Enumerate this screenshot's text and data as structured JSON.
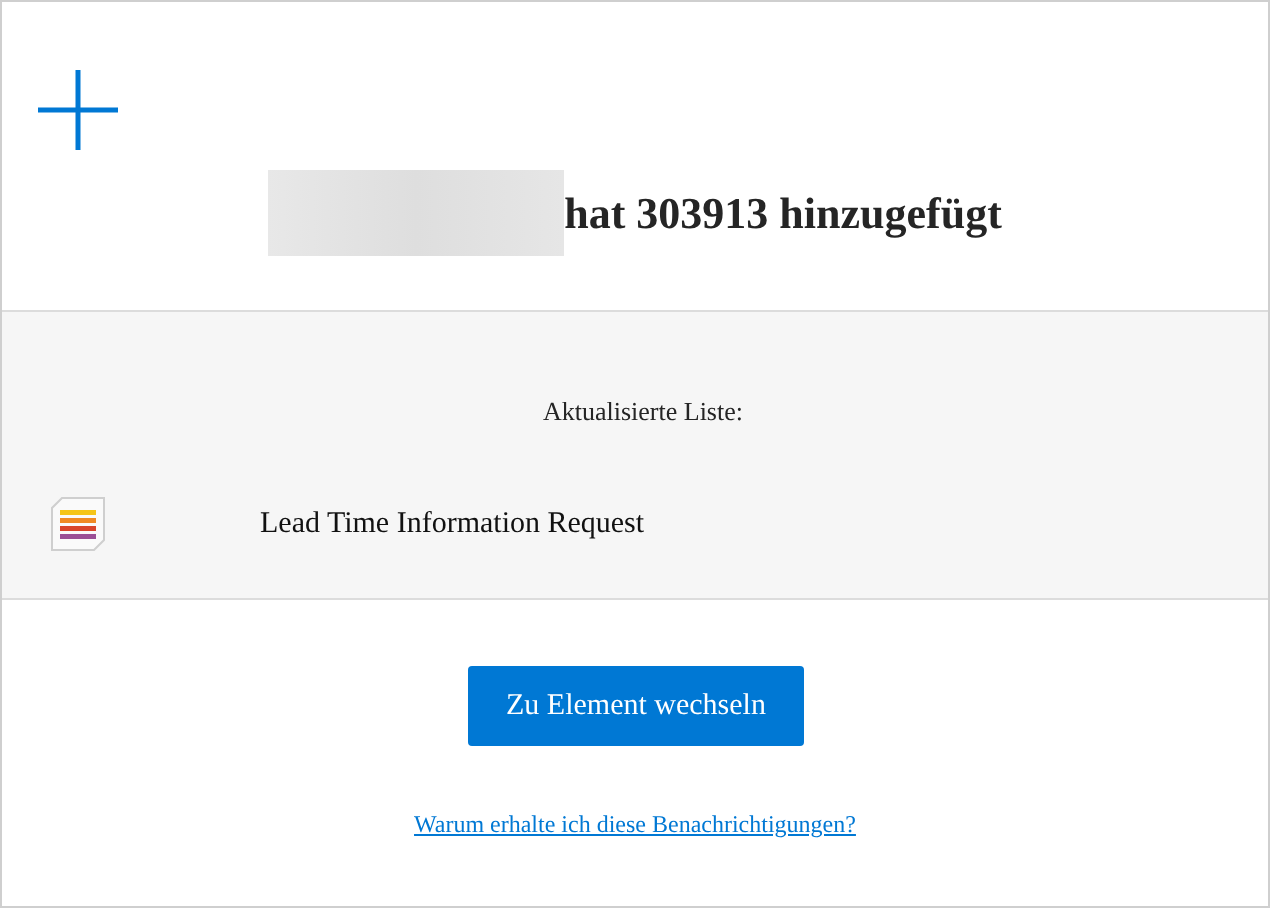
{
  "header": {
    "title": "hat 303913 hinzugefügt"
  },
  "list_section": {
    "label": "Aktualisierte Liste:",
    "items": [
      {
        "name": "Lead Time Information Request"
      }
    ]
  },
  "action_button": "Zu Element wechseln",
  "footer_link": "Warum erhalte ich diese Benachrichtigungen?"
}
